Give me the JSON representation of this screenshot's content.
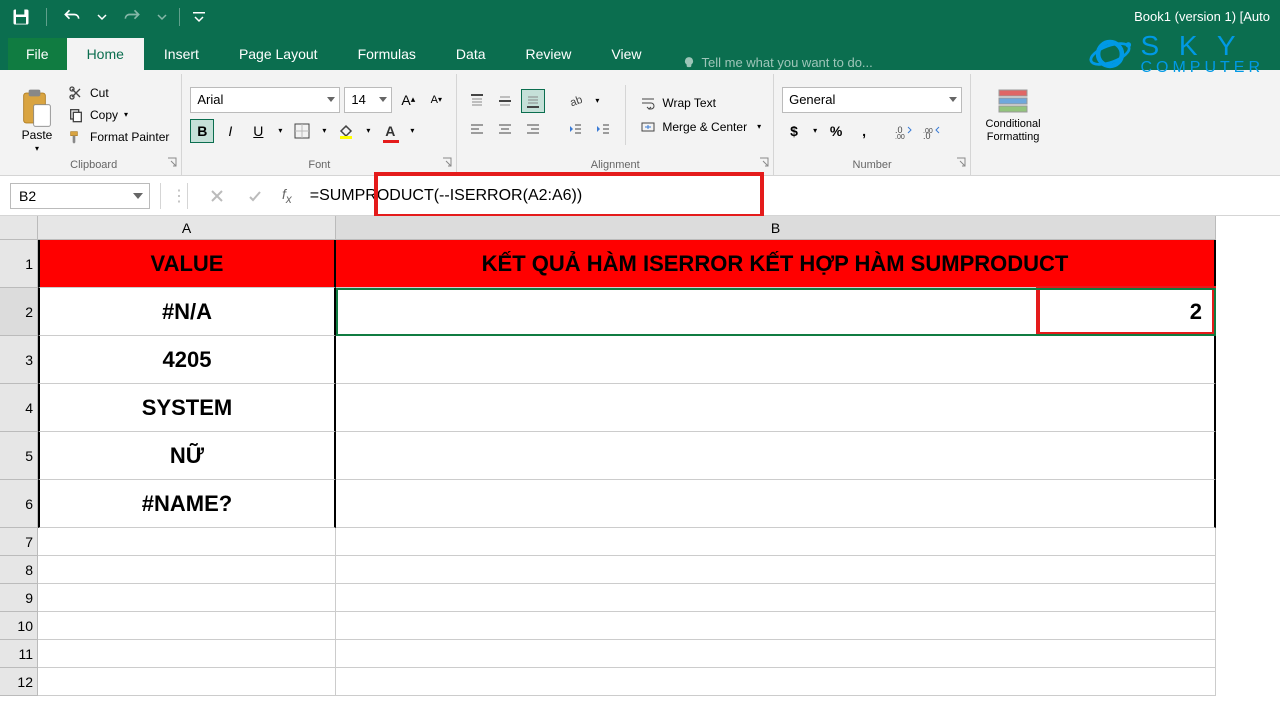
{
  "app": {
    "title": "Book1 (version 1) [Auto"
  },
  "qat": {
    "save": "Save",
    "undo": "Undo",
    "redo": "Redo"
  },
  "tabs": {
    "file": "File",
    "home": "Home",
    "insert": "Insert",
    "pagelayout": "Page Layout",
    "formulas": "Formulas",
    "data": "Data",
    "review": "Review",
    "view": "View",
    "tellme": "Tell me what you want to do..."
  },
  "ribbon": {
    "clipboard": {
      "paste": "Paste",
      "cut": "Cut",
      "copy": "Copy",
      "format_painter": "Format Painter",
      "label": "Clipboard"
    },
    "font": {
      "name": "Arial",
      "size": "14",
      "label": "Font"
    },
    "alignment": {
      "wrap_text": "Wrap Text",
      "merge_center": "Merge & Center",
      "label": "Alignment"
    },
    "number": {
      "format": "General",
      "label": "Number"
    },
    "styles": {
      "conditional_formatting": "Conditional Formatting"
    }
  },
  "formula_bar": {
    "name_box": "B2",
    "formula": "=SUMPRODUCT(--ISERROR(A2:A6))"
  },
  "grid": {
    "col_headers": {
      "A": "A",
      "B": "B"
    },
    "row_headers": [
      "1",
      "2",
      "3",
      "4",
      "5",
      "6",
      "7",
      "8",
      "9",
      "10",
      "11",
      "12"
    ],
    "cells": {
      "A1": "VALUE",
      "B1": "KẾT QUẢ HÀM ISERROR KẾT HỢP HÀM SUMPRODUCT",
      "A2": "#N/A",
      "B2": "2",
      "A3": "4205",
      "A4": "SYSTEM",
      "A5": "NỮ",
      "A6": "#NAME?"
    }
  },
  "logo": {
    "line1": "S K Y",
    "line2": "COMPUTER"
  },
  "chart_data": {
    "type": "table",
    "title": "ISERROR + SUMPRODUCT example",
    "columns": [
      "VALUE",
      "KẾT QUẢ HÀM ISERROR KẾT HỢP HÀM SUMPRODUCT"
    ],
    "rows": [
      [
        "#N/A",
        2
      ],
      [
        "4205",
        null
      ],
      [
        "SYSTEM",
        null
      ],
      [
        "NỮ",
        null
      ],
      [
        "#NAME?",
        null
      ]
    ],
    "formula": "=SUMPRODUCT(--ISERROR(A2:A6))",
    "result": 2
  }
}
